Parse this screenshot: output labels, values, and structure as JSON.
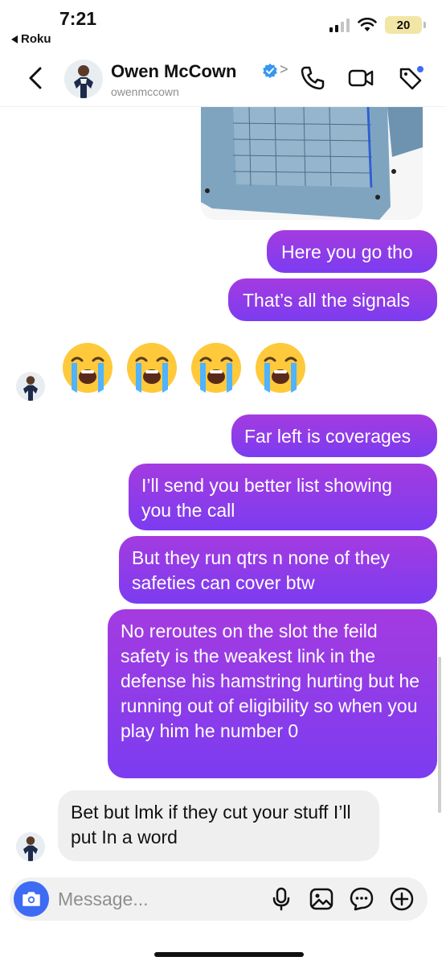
{
  "status_bar": {
    "time": "7:21",
    "back_app": "Roku",
    "battery": "20"
  },
  "header": {
    "name": "Owen McCown",
    "handle": "owenmccown"
  },
  "messages": {
    "m1": "Here you go tho",
    "m2": "That’s all the signals",
    "emoji": [
      "😭",
      "😭",
      "😭",
      "😭"
    ],
    "m3": "Far left is coverages",
    "m4": "I’ll send you better list showing you the call",
    "m5": "But they run qtrs n none of they safeties can cover btw",
    "m6": "No reroutes on the slot the feild safety is the weakest link in the defense his hamstring hurting but he running out of eligibility so when you play him he number 0",
    "m7": "Bet but lmk if they cut your stuff I’ll put In a word"
  },
  "composer": {
    "placeholder": "Message..."
  },
  "colors": {
    "sent_top": "#a43be0",
    "sent_bottom": "#7b3cf0",
    "received": "#efefef",
    "accent_blue": "#3d6bf4",
    "verified": "#3797f0"
  },
  "icons": [
    "back-chevron-icon",
    "verified-badge-icon",
    "phone-icon",
    "video-icon",
    "tag-icon",
    "camera-icon",
    "mic-icon",
    "gallery-icon",
    "sticker-icon",
    "plus-icon"
  ]
}
